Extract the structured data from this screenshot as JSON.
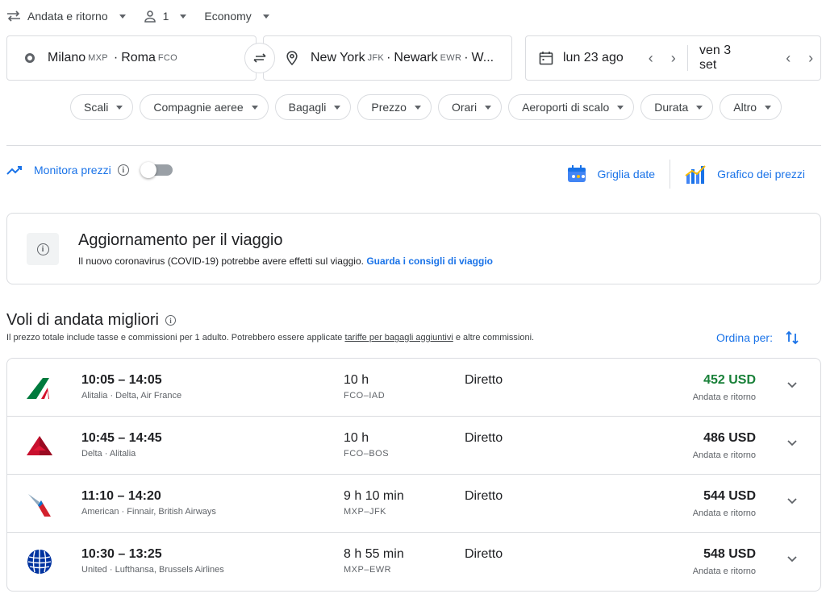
{
  "topbar": {
    "trip_type": "Andata e ritorno",
    "passengers": "1",
    "cabin": "Economy"
  },
  "search": {
    "origin_city1": "Milano",
    "origin_code1": "MXP",
    "origin_sep": "·",
    "origin_city2": "Roma",
    "origin_code2": "FCO",
    "dest_city1": "New York",
    "dest_code1": "JFK",
    "dest_sep1": "·",
    "dest_city2": "Newark",
    "dest_code2": "EWR",
    "dest_sep2": "·",
    "dest_more": "W...",
    "depart_date": "lun 23 ago",
    "return_date": "ven 3 set"
  },
  "filters": [
    "Scali",
    "Compagnie aeree",
    "Bagagli",
    "Prezzo",
    "Orari",
    "Aeroporti di scalo",
    "Durata",
    "Altro"
  ],
  "monitor": {
    "label": "Monitora prezzi"
  },
  "tools": {
    "date_grid": "Griglia date",
    "price_graph": "Grafico dei prezzi"
  },
  "alert": {
    "title": "Aggiornamento per il viaggio",
    "body": "Il nuovo coronavirus (COVID-19) potrebbe avere effetti sul viaggio.",
    "link": "Guarda i consigli di viaggio"
  },
  "results": {
    "title": "Voli di andata migliori",
    "subtitle_pre": "Il prezzo totale include tasse e commissioni per 1 adulto. Potrebbero essere applicate",
    "subtitle_link": "tariffe per bagagli aggiuntivi",
    "subtitle_post": "e altre commissioni.",
    "sort_label": "Ordina per:"
  },
  "flights": [
    {
      "logo": "alitalia-logo",
      "times": "10:05 – 14:05",
      "airlines": "Alitalia · Delta, Air France",
      "duration": "10 h",
      "route": "FCO–IAD",
      "stops": "Diretto",
      "price": "452 USD",
      "price_type": "Andata e ritorno",
      "price_color": "#188038"
    },
    {
      "logo": "delta-logo",
      "times": "10:45 – 14:45",
      "airlines": "Delta · Alitalia",
      "duration": "10 h",
      "route": "FCO–BOS",
      "stops": "Diretto",
      "price": "486 USD",
      "price_type": "Andata e ritorno",
      "price_color": "#202124"
    },
    {
      "logo": "american-logo",
      "times": "11:10 – 14:20",
      "airlines": "American · Finnair, British Airways",
      "duration": "9 h 10 min",
      "route": "MXP–JFK",
      "stops": "Diretto",
      "price": "544 USD",
      "price_type": "Andata e ritorno",
      "price_color": "#202124"
    },
    {
      "logo": "united-logo",
      "times": "10:30 – 13:25",
      "airlines": "United · Lufthansa, Brussels Airlines",
      "duration": "8 h 55 min",
      "route": "MXP–EWR",
      "stops": "Diretto",
      "price": "548 USD",
      "price_type": "Andata e ritorno",
      "price_color": "#202124"
    }
  ],
  "colors": {
    "accent": "#1a73e8",
    "price_best": "#188038",
    "border": "#dadce0"
  }
}
